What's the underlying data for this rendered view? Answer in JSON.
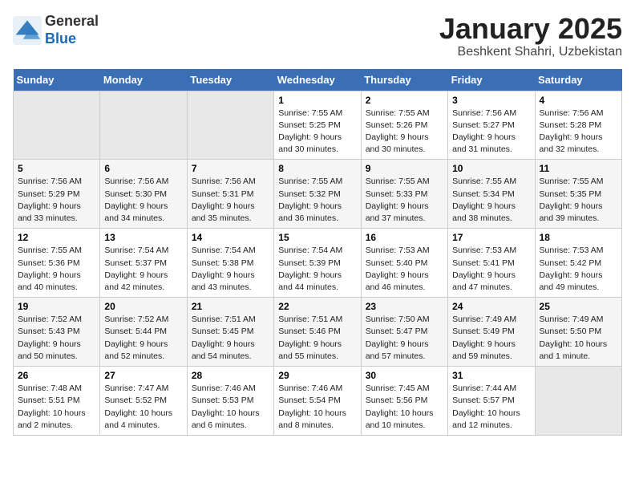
{
  "header": {
    "logo_line1": "General",
    "logo_line2": "Blue",
    "month": "January 2025",
    "location": "Beshkent Shahri, Uzbekistan"
  },
  "weekdays": [
    "Sunday",
    "Monday",
    "Tuesday",
    "Wednesday",
    "Thursday",
    "Friday",
    "Saturday"
  ],
  "weeks": [
    [
      {
        "day": "",
        "content": ""
      },
      {
        "day": "",
        "content": ""
      },
      {
        "day": "",
        "content": ""
      },
      {
        "day": "1",
        "content": "Sunrise: 7:55 AM\nSunset: 5:25 PM\nDaylight: 9 hours and 30 minutes."
      },
      {
        "day": "2",
        "content": "Sunrise: 7:55 AM\nSunset: 5:26 PM\nDaylight: 9 hours and 30 minutes."
      },
      {
        "day": "3",
        "content": "Sunrise: 7:56 AM\nSunset: 5:27 PM\nDaylight: 9 hours and 31 minutes."
      },
      {
        "day": "4",
        "content": "Sunrise: 7:56 AM\nSunset: 5:28 PM\nDaylight: 9 hours and 32 minutes."
      }
    ],
    [
      {
        "day": "5",
        "content": "Sunrise: 7:56 AM\nSunset: 5:29 PM\nDaylight: 9 hours and 33 minutes."
      },
      {
        "day": "6",
        "content": "Sunrise: 7:56 AM\nSunset: 5:30 PM\nDaylight: 9 hours and 34 minutes."
      },
      {
        "day": "7",
        "content": "Sunrise: 7:56 AM\nSunset: 5:31 PM\nDaylight: 9 hours and 35 minutes."
      },
      {
        "day": "8",
        "content": "Sunrise: 7:55 AM\nSunset: 5:32 PM\nDaylight: 9 hours and 36 minutes."
      },
      {
        "day": "9",
        "content": "Sunrise: 7:55 AM\nSunset: 5:33 PM\nDaylight: 9 hours and 37 minutes."
      },
      {
        "day": "10",
        "content": "Sunrise: 7:55 AM\nSunset: 5:34 PM\nDaylight: 9 hours and 38 minutes."
      },
      {
        "day": "11",
        "content": "Sunrise: 7:55 AM\nSunset: 5:35 PM\nDaylight: 9 hours and 39 minutes."
      }
    ],
    [
      {
        "day": "12",
        "content": "Sunrise: 7:55 AM\nSunset: 5:36 PM\nDaylight: 9 hours and 40 minutes."
      },
      {
        "day": "13",
        "content": "Sunrise: 7:54 AM\nSunset: 5:37 PM\nDaylight: 9 hours and 42 minutes."
      },
      {
        "day": "14",
        "content": "Sunrise: 7:54 AM\nSunset: 5:38 PM\nDaylight: 9 hours and 43 minutes."
      },
      {
        "day": "15",
        "content": "Sunrise: 7:54 AM\nSunset: 5:39 PM\nDaylight: 9 hours and 44 minutes."
      },
      {
        "day": "16",
        "content": "Sunrise: 7:53 AM\nSunset: 5:40 PM\nDaylight: 9 hours and 46 minutes."
      },
      {
        "day": "17",
        "content": "Sunrise: 7:53 AM\nSunset: 5:41 PM\nDaylight: 9 hours and 47 minutes."
      },
      {
        "day": "18",
        "content": "Sunrise: 7:53 AM\nSunset: 5:42 PM\nDaylight: 9 hours and 49 minutes."
      }
    ],
    [
      {
        "day": "19",
        "content": "Sunrise: 7:52 AM\nSunset: 5:43 PM\nDaylight: 9 hours and 50 minutes."
      },
      {
        "day": "20",
        "content": "Sunrise: 7:52 AM\nSunset: 5:44 PM\nDaylight: 9 hours and 52 minutes."
      },
      {
        "day": "21",
        "content": "Sunrise: 7:51 AM\nSunset: 5:45 PM\nDaylight: 9 hours and 54 minutes."
      },
      {
        "day": "22",
        "content": "Sunrise: 7:51 AM\nSunset: 5:46 PM\nDaylight: 9 hours and 55 minutes."
      },
      {
        "day": "23",
        "content": "Sunrise: 7:50 AM\nSunset: 5:47 PM\nDaylight: 9 hours and 57 minutes."
      },
      {
        "day": "24",
        "content": "Sunrise: 7:49 AM\nSunset: 5:49 PM\nDaylight: 9 hours and 59 minutes."
      },
      {
        "day": "25",
        "content": "Sunrise: 7:49 AM\nSunset: 5:50 PM\nDaylight: 10 hours and 1 minute."
      }
    ],
    [
      {
        "day": "26",
        "content": "Sunrise: 7:48 AM\nSunset: 5:51 PM\nDaylight: 10 hours and 2 minutes."
      },
      {
        "day": "27",
        "content": "Sunrise: 7:47 AM\nSunset: 5:52 PM\nDaylight: 10 hours and 4 minutes."
      },
      {
        "day": "28",
        "content": "Sunrise: 7:46 AM\nSunset: 5:53 PM\nDaylight: 10 hours and 6 minutes."
      },
      {
        "day": "29",
        "content": "Sunrise: 7:46 AM\nSunset: 5:54 PM\nDaylight: 10 hours and 8 minutes."
      },
      {
        "day": "30",
        "content": "Sunrise: 7:45 AM\nSunset: 5:56 PM\nDaylight: 10 hours and 10 minutes."
      },
      {
        "day": "31",
        "content": "Sunrise: 7:44 AM\nSunset: 5:57 PM\nDaylight: 10 hours and 12 minutes."
      },
      {
        "day": "",
        "content": ""
      }
    ]
  ]
}
